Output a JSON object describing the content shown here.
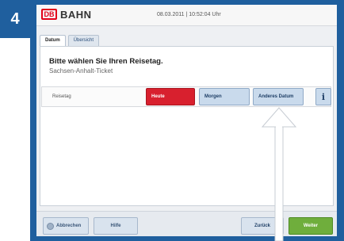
{
  "step_number": "4",
  "header": {
    "logo_text": "DB",
    "brand": "BAHN",
    "datetime": "08.03.2011 | 10:52:04 Uhr"
  },
  "tabs": [
    {
      "label": "Datum"
    },
    {
      "label": "Übersicht"
    }
  ],
  "main": {
    "headline": "Bitte wählen Sie Ihren Reisetag.",
    "subline": "Sachsen-Anhalt-Ticket",
    "field_label": "Reisetag",
    "options": [
      {
        "label": "Heute",
        "selected": true
      },
      {
        "label": "Morgen",
        "selected": false
      },
      {
        "label": "Anderes Datum",
        "selected": false
      }
    ],
    "info_label": "i"
  },
  "footer": {
    "cancel_label": "Abbrechen",
    "help_label": "Hilfe",
    "back_label": "Zurück",
    "next_label": "Weiter"
  },
  "colors": {
    "frame_blue": "#1f5f9e",
    "selected_red": "#d8202e",
    "next_green": "#6fae3c"
  },
  "icons": {
    "pointer_arrow": "arrow-up-icon"
  }
}
